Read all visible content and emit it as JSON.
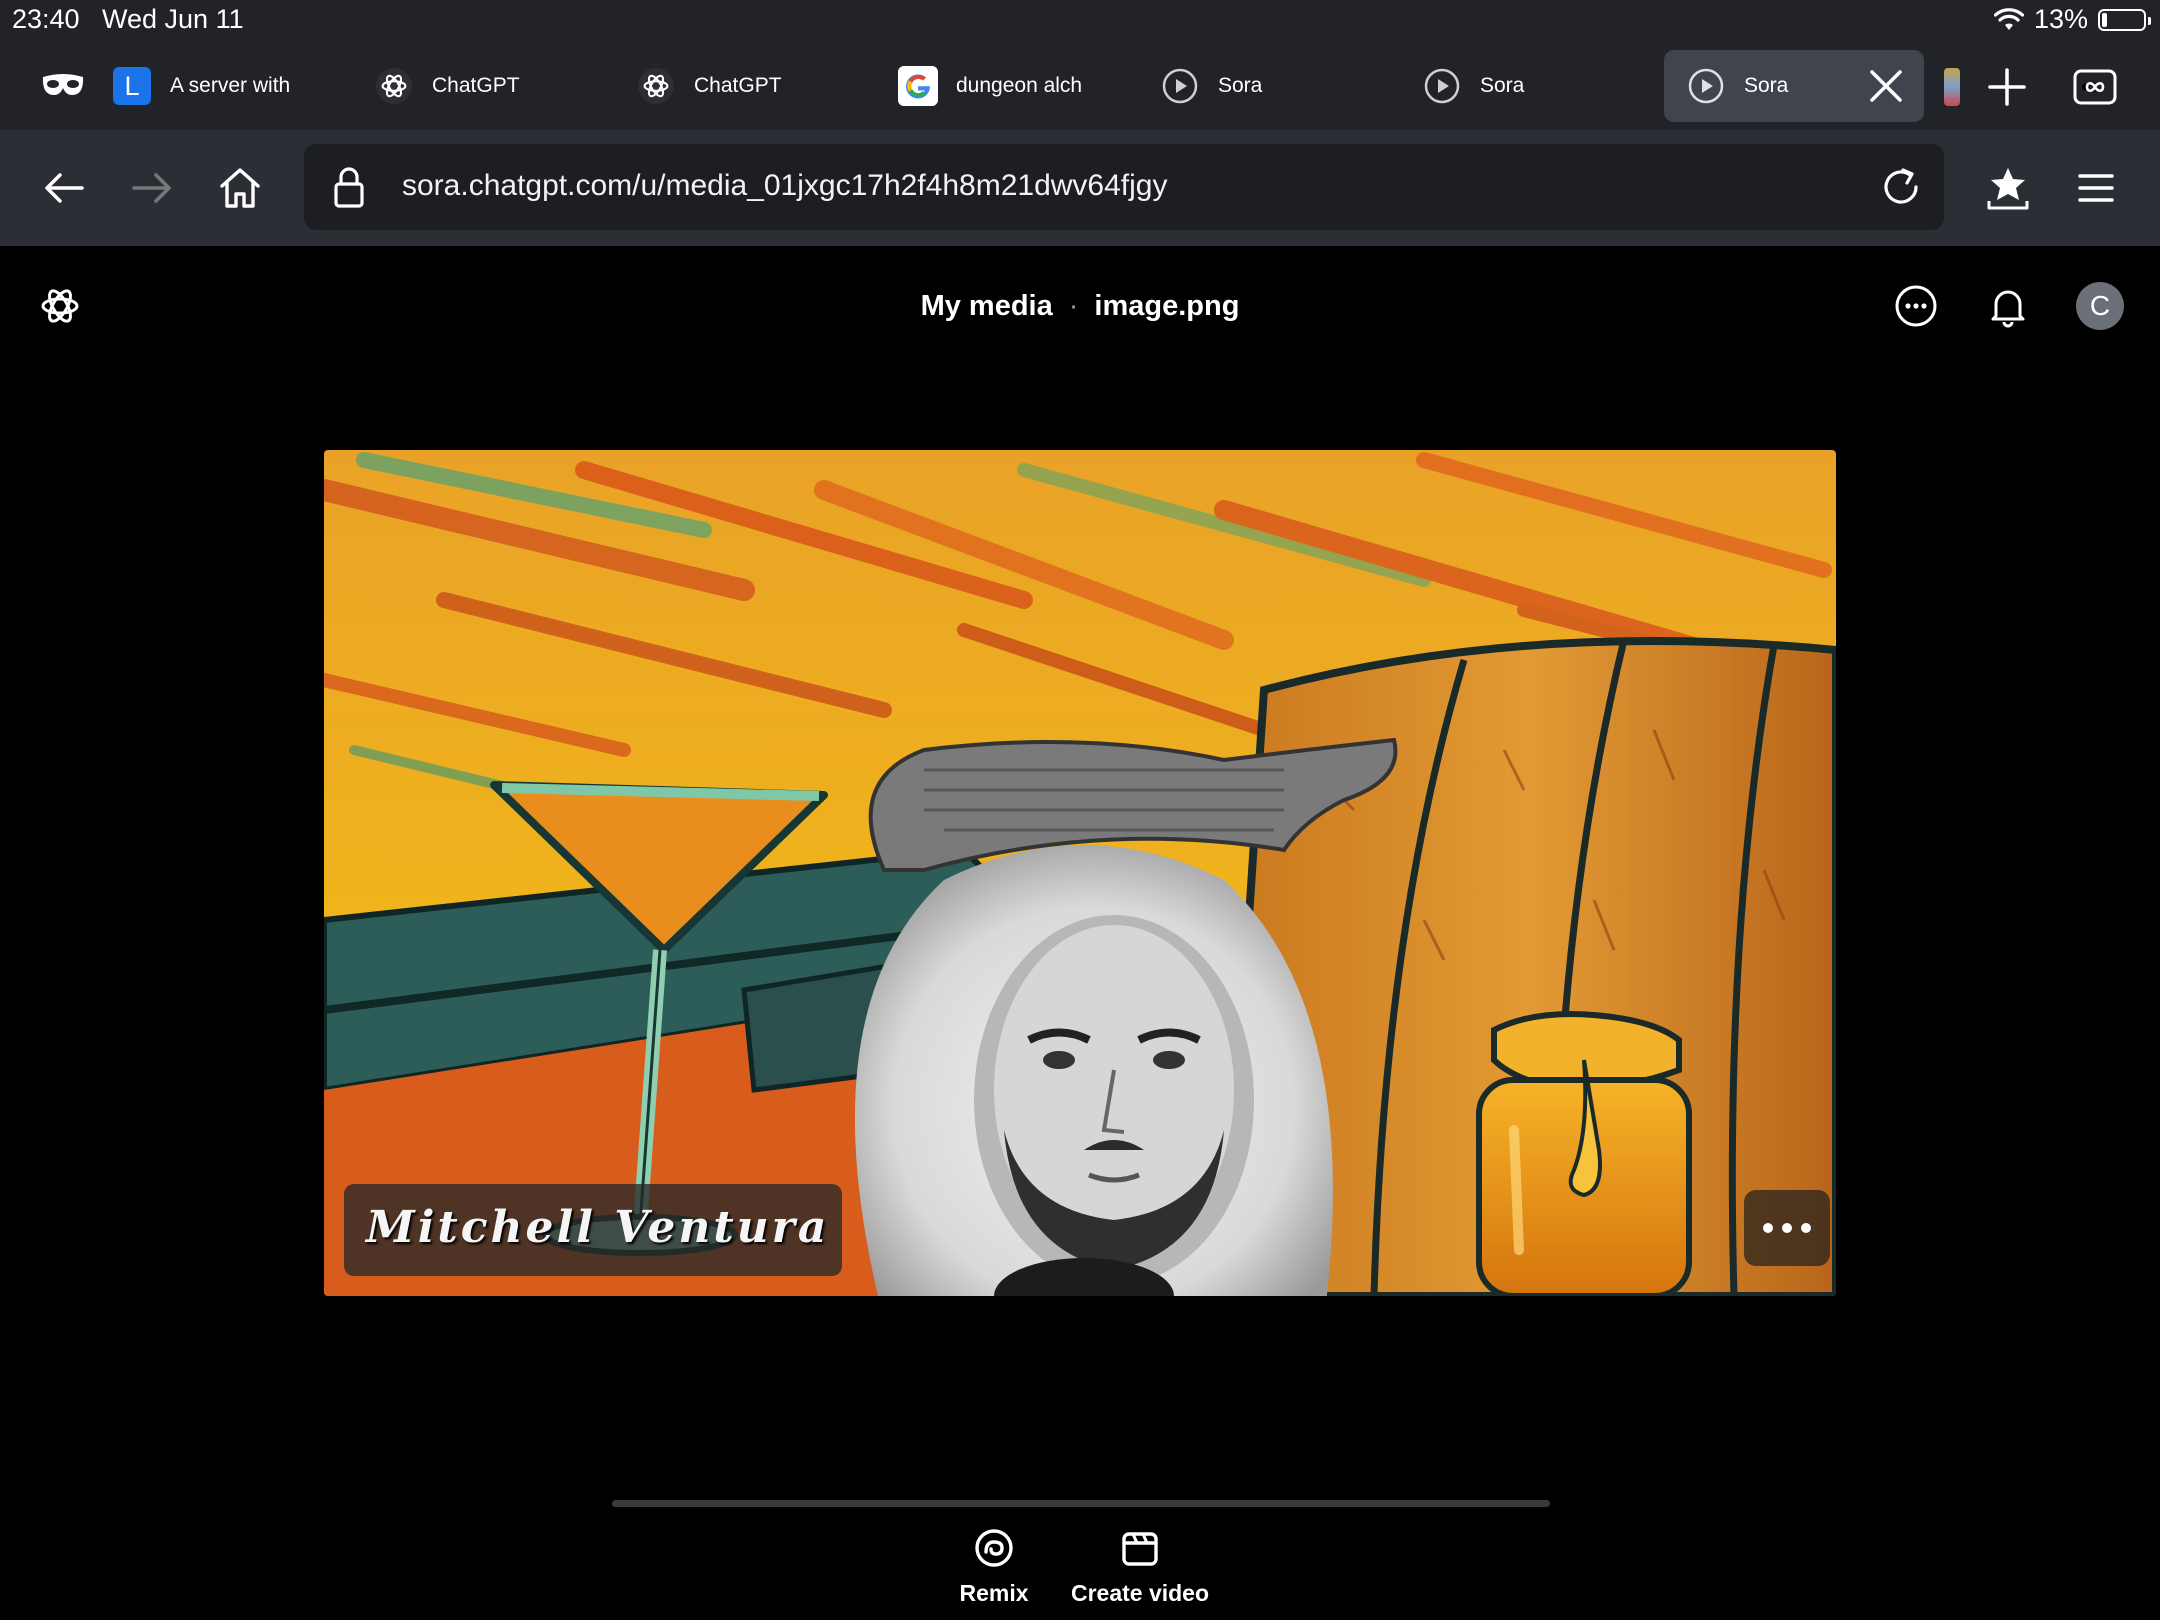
{
  "status_bar": {
    "time": "23:40",
    "date": "Wed Jun 11",
    "battery_percent": "13%",
    "battery_level": 0.13,
    "icons": [
      "wifi-icon",
      "battery-icon"
    ]
  },
  "tabs": [
    {
      "title": "",
      "favicon": "private-mask-icon"
    },
    {
      "title": "A server with",
      "favicon": "L"
    },
    {
      "title": "ChatGPT",
      "favicon": "openai-icon"
    },
    {
      "title": "ChatGPT",
      "favicon": "openai-icon"
    },
    {
      "title": "dungeon alch",
      "favicon": "google-icon"
    },
    {
      "title": "Sora",
      "favicon": "sora-play-icon"
    },
    {
      "title": "Sora",
      "favicon": "sora-play-icon"
    },
    {
      "title": "Sora",
      "favicon": "sora-play-icon",
      "active": true
    }
  ],
  "address_bar": {
    "url": "sora.chatgpt.com/u/media_01jxgc17h2f4h8m21dwv64fjgy"
  },
  "app_header": {
    "breadcrumb_parent": "My media",
    "separator": "·",
    "breadcrumb_current": "image.png",
    "avatar_initial": "C"
  },
  "media": {
    "caption": "Mitchell Ventura"
  },
  "actions": {
    "remix_label": "Remix",
    "create_video_label": "Create video"
  },
  "colors": {
    "chrome_bg": "#222328",
    "nav_bg": "#2c2e35",
    "url_bg": "#1d1e22",
    "active_tab_bg": "#41444d",
    "page_bg": "#000000"
  }
}
